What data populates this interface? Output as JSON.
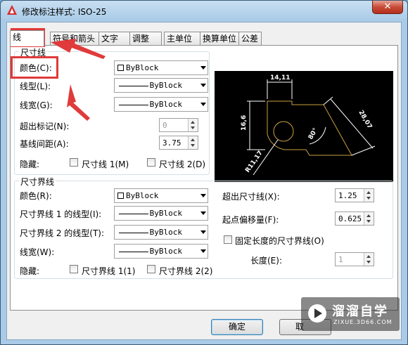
{
  "window": {
    "title": "修改标注样式: ISO-25",
    "close_label": "✕"
  },
  "tabs": [
    {
      "label": "线",
      "active": true
    },
    {
      "label": "符号和箭头"
    },
    {
      "label": "文字"
    },
    {
      "label": "调整"
    },
    {
      "label": "主单位"
    },
    {
      "label": "换算单位"
    },
    {
      "label": "公差"
    }
  ],
  "dim_lines": {
    "title": "尺寸线",
    "color_label": "颜色(C):",
    "color_value": "ByBlock",
    "linetype_label": "线型(L):",
    "linetype_value": "ByBlock",
    "lineweight_label": "线宽(G):",
    "lineweight_value": "ByBlock",
    "extend_ticks_label": "超出标记(N):",
    "extend_ticks_value": "0",
    "baseline_spacing_label": "基线间距(A):",
    "baseline_spacing_value": "3.75",
    "suppress_label": "隐藏:",
    "suppress_1": "尺寸线 1(M)",
    "suppress_2": "尺寸线 2(D)"
  },
  "preview": {
    "dim_top": "14,11",
    "dim_left": "16,6",
    "dim_right": "28,07",
    "dim_angle": "80°",
    "dim_radius": "R11,17"
  },
  "ext_lines": {
    "title": "尺寸界线",
    "color_label": "颜色(R):",
    "color_value": "ByBlock",
    "linetype1_label": "尺寸界线 1 的线型(I):",
    "linetype1_value": "ByBlock",
    "linetype2_label": "尺寸界线 2 的线型(T):",
    "linetype2_value": "ByBlock",
    "lineweight_label": "线宽(W):",
    "lineweight_value": "ByBlock",
    "suppress_label": "隐藏:",
    "suppress_1": "尺寸界线 1(1)",
    "suppress_2": "尺寸界线 2(2)",
    "extend_beyond_label": "超出尺寸线(X):",
    "extend_beyond_value": "1.25",
    "offset_label": "起点偏移量(F):",
    "offset_value": "0.625",
    "fixed_length_label": "固定长度的尺寸界线(O)",
    "length_label": "长度(E):",
    "length_value": "1"
  },
  "buttons": {
    "ok": "确定",
    "cancel": "取"
  },
  "watermark": {
    "main": "溜溜自学",
    "sub": "ZIXUE.3D66.COM"
  },
  "colors": {
    "annotation_red": "#e03a3a",
    "preview_bg": "#000000",
    "preview_geometry": "#c8a040"
  }
}
